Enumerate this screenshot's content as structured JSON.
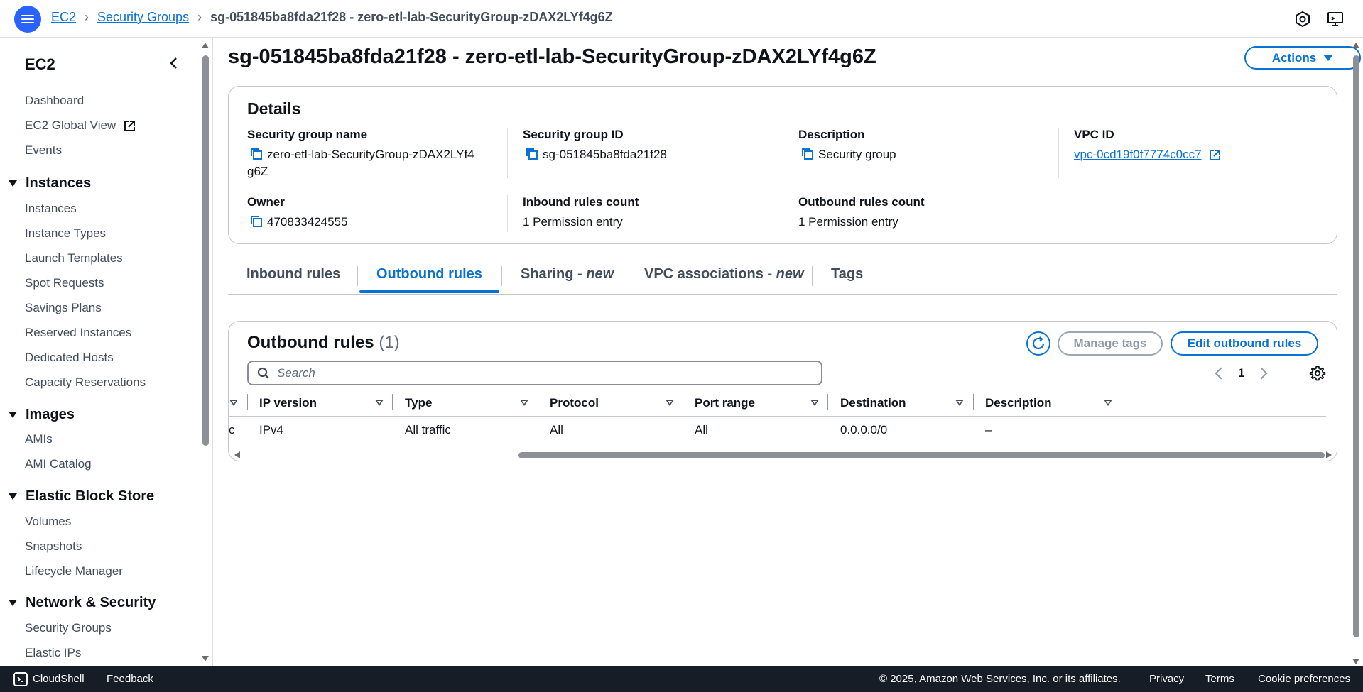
{
  "breadcrumb": {
    "items": [
      "EC2",
      "Security Groups"
    ],
    "current": "sg-051845ba8fda21f28 - zero-etl-lab-SecurityGroup-zDAX2LYf4g6Z"
  },
  "sidebar": {
    "title": "EC2",
    "top_links": [
      "Dashboard",
      "EC2 Global View",
      "Events"
    ],
    "sections": [
      {
        "title": "Instances",
        "items": [
          "Instances",
          "Instance Types",
          "Launch Templates",
          "Spot Requests",
          "Savings Plans",
          "Reserved Instances",
          "Dedicated Hosts",
          "Capacity Reservations"
        ]
      },
      {
        "title": "Images",
        "items": [
          "AMIs",
          "AMI Catalog"
        ]
      },
      {
        "title": "Elastic Block Store",
        "items": [
          "Volumes",
          "Snapshots",
          "Lifecycle Manager"
        ]
      },
      {
        "title": "Network & Security",
        "items": [
          "Security Groups",
          "Elastic IPs"
        ]
      }
    ]
  },
  "page": {
    "title": "sg-051845ba8fda21f28 - zero-etl-lab-SecurityGroup-zDAX2LYf4g6Z",
    "actions_label": "Actions"
  },
  "details": {
    "heading": "Details",
    "fields": {
      "sg_name": {
        "label": "Security group name",
        "value_line1": "zero-etl-lab-SecurityGroup-zDAX2LYf4",
        "value_line2": "g6Z"
      },
      "sg_id": {
        "label": "Security group ID",
        "value": "sg-051845ba8fda21f28"
      },
      "description": {
        "label": "Description",
        "value": "Security group"
      },
      "vpc_id": {
        "label": "VPC ID",
        "value": "vpc-0cd19f0f7774c0cc7"
      },
      "owner": {
        "label": "Owner",
        "value": "470833424555"
      },
      "inbound_count": {
        "label": "Inbound rules count",
        "value": "1 Permission entry"
      },
      "outbound_count": {
        "label": "Outbound rules count",
        "value": "1 Permission entry"
      }
    }
  },
  "tabs": [
    {
      "label": "Inbound rules",
      "suffix": ""
    },
    {
      "label": "Outbound rules",
      "suffix": ""
    },
    {
      "label": "Sharing - ",
      "suffix": "new"
    },
    {
      "label": "VPC associations - ",
      "suffix": "new"
    },
    {
      "label": "Tags",
      "suffix": ""
    }
  ],
  "active_tab": "Outbound rules",
  "outbound": {
    "title": "Outbound rules",
    "count": "(1)",
    "manage_tags_label": "Manage tags",
    "edit_label": "Edit outbound rules",
    "search_placeholder": "Search",
    "page_number": "1",
    "columns": [
      "IP version",
      "Type",
      "Protocol",
      "Port range",
      "Destination",
      "Description"
    ],
    "rows": [
      {
        "lead": "c",
        "cells": [
          "IPv4",
          "All traffic",
          "All",
          "All",
          "0.0.0.0/0",
          "–"
        ]
      }
    ]
  },
  "footer": {
    "cloudshell": "CloudShell",
    "feedback": "Feedback",
    "copyright": "© 2025, Amazon Web Services, Inc. or its affiliates.",
    "privacy": "Privacy",
    "terms": "Terms",
    "cookie": "Cookie preferences"
  },
  "colors": {
    "link": "#0972d3",
    "menu_button": "#2962ff",
    "footer_bg": "#161d26"
  }
}
